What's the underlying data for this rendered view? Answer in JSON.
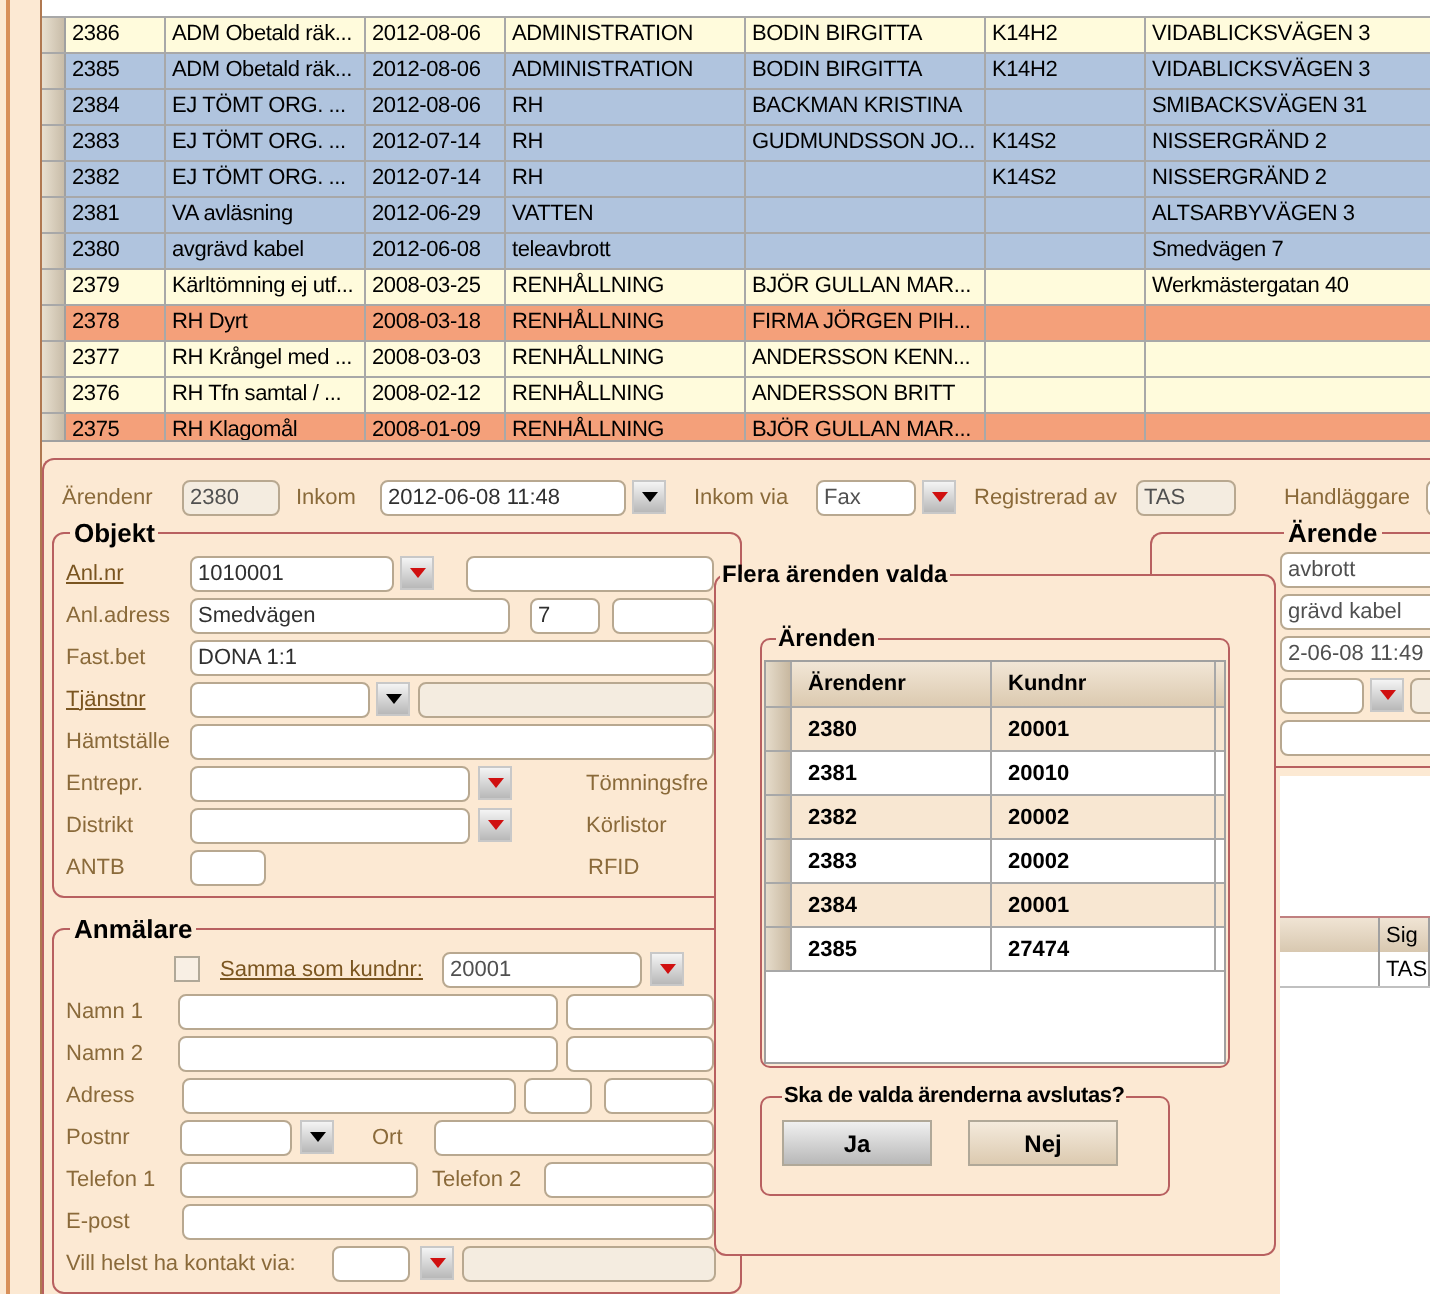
{
  "cases_table": {
    "rows": [
      {
        "cells": [
          "2386",
          "ADM Obetald räk...",
          "2012-08-06",
          "ADMINISTRATION",
          "BODIN BIRGITTA",
          "K14H2",
          "VIDABLICKSVÄGEN 3"
        ],
        "color": "#fffbdc"
      },
      {
        "cells": [
          "2385",
          "ADM Obetald räk...",
          "2012-08-06",
          "ADMINISTRATION",
          "BODIN BIRGITTA",
          "K14H2",
          "VIDABLICKSVÄGEN 3"
        ],
        "color": "#b0c4de"
      },
      {
        "cells": [
          "2384",
          "EJ TÖMT ORG. ...",
          "2012-08-06",
          "RH",
          "BACKMAN KRISTINA",
          "",
          "SMIBACKSVÄGEN 31"
        ],
        "color": "#b0c4de"
      },
      {
        "cells": [
          "2383",
          "EJ TÖMT ORG. ...",
          "2012-07-14",
          "RH",
          "GUDMUNDSSON JO...",
          "K14S2",
          "NISSERGRÄND 2"
        ],
        "color": "#b0c4de"
      },
      {
        "cells": [
          "2382",
          "EJ TÖMT ORG. ...",
          "2012-07-14",
          "RH",
          "",
          "K14S2",
          "NISSERGRÄND 2"
        ],
        "color": "#b0c4de"
      },
      {
        "cells": [
          "2381",
          "VA avläsning",
          "2012-06-29",
          "VATTEN",
          "",
          "",
          "ALTSARBYVÄGEN 3"
        ],
        "color": "#b0c4de"
      },
      {
        "cells": [
          "2380",
          "avgrävd kabel",
          "2012-06-08",
          "teleavbrott",
          "",
          "",
          "Smedvägen 7"
        ],
        "color": "#b0c4de"
      },
      {
        "cells": [
          "2379",
          "Kärltömning ej utf...",
          "2008-03-25",
          "RENHÅLLNING",
          "BJÖR GULLAN MAR...",
          "",
          "Werkmästergatan 40"
        ],
        "color": "#fffbdc"
      },
      {
        "cells": [
          "2378",
          "RH Dyrt",
          "2008-03-18",
          "RENHÅLLNING",
          "FIRMA JÖRGEN PIH...",
          "",
          ""
        ],
        "color": "#f4a07a"
      },
      {
        "cells": [
          "2377",
          "RH Krångel med ...",
          "2008-03-03",
          "RENHÅLLNING",
          "ANDERSSON KENN...",
          "",
          ""
        ],
        "color": "#fffbdc"
      },
      {
        "cells": [
          "2376",
          "RH Tfn samtal / ...",
          "2008-02-12",
          "RENHÅLLNING",
          "ANDERSSON BRITT",
          "",
          ""
        ],
        "color": "#fffbdc"
      },
      {
        "cells": [
          "2375",
          "RH Klagomål",
          "2008-01-09",
          "RENHÅLLNING",
          "BJÖR GULLAN MAR...",
          "",
          ""
        ],
        "color": "#f4a07a"
      }
    ]
  },
  "header": {
    "arendenr": {
      "label": "Ärendenr",
      "value": "2380"
    },
    "inkom": {
      "label": "Inkom",
      "value": "2012-06-08 11:48"
    },
    "inkom_via": {
      "label": "Inkom via",
      "value": "Fax"
    },
    "registrerad_av": {
      "label": "Registrerad av",
      "value": "TAS"
    },
    "handlaggare": {
      "label": "Handläggare"
    }
  },
  "objekt": {
    "title": "Objekt",
    "anl_nr": {
      "label": "Anl.nr",
      "value": "1010001"
    },
    "anl_adress": {
      "label": "Anl.adress",
      "street": "Smedvägen",
      "number": "7"
    },
    "fast_bet": {
      "label": "Fast.bet",
      "value": "DONA 1:1"
    },
    "tjanstnr": {
      "label": "Tjänstnr"
    },
    "hamtstalle": {
      "label": "Hämtställe"
    },
    "entrepr": {
      "label": "Entrepr."
    },
    "distrikt": {
      "label": "Distrikt"
    },
    "antb": {
      "label": "ANTB"
    },
    "tomningsfre": {
      "label": "Tömningsfre"
    },
    "korlistor": {
      "label": "Körlistor"
    },
    "rfid": {
      "label": "RFID"
    }
  },
  "anmalare": {
    "title": "Anmälare",
    "same_as_customer": {
      "label": "Samma som kundnr:",
      "checked": false,
      "value": "20001"
    },
    "namn1": "Namn 1",
    "namn2": "Namn 2",
    "adress": "Adress",
    "postnr": "Postnr",
    "ort": "Ort",
    "telefon1": "Telefon 1",
    "telefon2": "Telefon 2",
    "epost": "E-post",
    "kontakt": "Vill helst ha kontakt via:"
  },
  "arende": {
    "title": "Ärende",
    "fields": [
      "avbrott",
      "grävd kabel",
      "2-06-08 11:49"
    ],
    "log_table": {
      "column": "Sig",
      "cell": "TAS"
    }
  },
  "dialog": {
    "title": "Flera ärenden valda",
    "group": "Ärenden",
    "columns": [
      "Ärendenr",
      "Kundnr"
    ],
    "rows": [
      {
        "cells": [
          "2380",
          "20001"
        ]
      },
      {
        "cells": [
          "2381",
          "20010"
        ]
      },
      {
        "cells": [
          "2382",
          "20002"
        ]
      },
      {
        "cells": [
          "2383",
          "20002"
        ]
      },
      {
        "cells": [
          "2384",
          "20001"
        ]
      },
      {
        "cells": [
          "2385",
          "27474"
        ]
      }
    ],
    "question": "Ska de valda ärenderna avslutas?",
    "buttons": [
      {
        "label": "Ja",
        "focused": true
      },
      {
        "label": "Nej",
        "focused": false
      }
    ]
  }
}
